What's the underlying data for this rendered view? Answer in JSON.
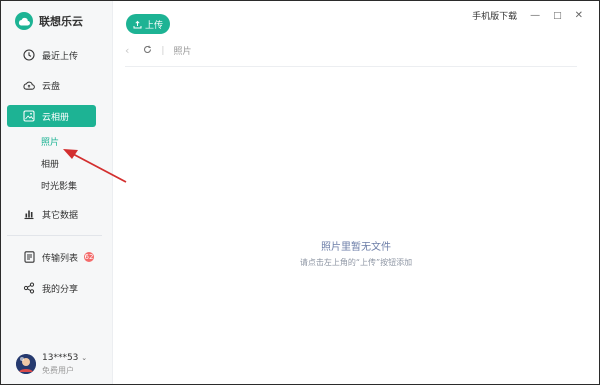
{
  "app": {
    "name": "联想乐云"
  },
  "sidebar": {
    "items": [
      {
        "label": "最近上传",
        "icon": "clock-icon"
      },
      {
        "label": "云盘",
        "icon": "cloud-icon"
      },
      {
        "label": "云相册",
        "icon": "album-icon"
      },
      {
        "label": "其它数据",
        "icon": "bar-chart-icon"
      },
      {
        "label": "传输列表",
        "icon": "transfer-list-icon"
      },
      {
        "label": "我的分享",
        "icon": "share-icon"
      }
    ],
    "sub_items": [
      {
        "label": "照片"
      },
      {
        "label": "相册"
      },
      {
        "label": "时光影集"
      }
    ],
    "transfer_badge": "62",
    "user": {
      "name": "13***53",
      "type": "免费用户"
    }
  },
  "toolbar": {
    "upload_label": "上传",
    "mobile_download": "手机版下载"
  },
  "breadcrumb": {
    "current": "照片"
  },
  "empty_state": {
    "title": "照片里暂无文件",
    "subtitle": "请点击左上角的“上传”按钮添加"
  },
  "colors": {
    "accent": "#1db394",
    "badge": "#f46b6b",
    "arrow": "#d32f2f"
  }
}
